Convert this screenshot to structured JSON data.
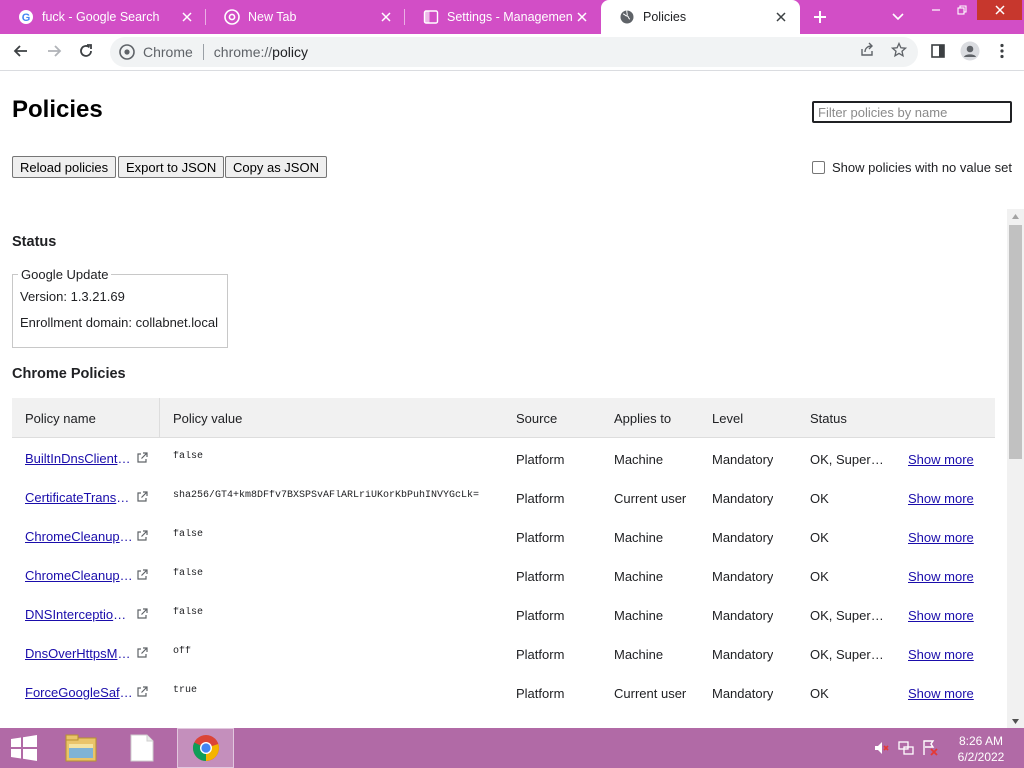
{
  "tabs": [
    {
      "title": "fuck - Google Search",
      "icon": "google-icon",
      "active": false
    },
    {
      "title": "New Tab",
      "icon": "chrome-icon",
      "active": false
    },
    {
      "title": "Settings - Management",
      "icon": "settings-icon",
      "active": false
    },
    {
      "title": "Policies",
      "icon": "globe-icon",
      "active": true
    }
  ],
  "omnibox": {
    "chip": "Chrome",
    "url_scheme": "chrome://",
    "url_host": "policy"
  },
  "page": {
    "title": "Policies",
    "filter_placeholder": "Filter policies by name",
    "buttons": {
      "reload": "Reload policies",
      "export": "Export to JSON",
      "copy": "Copy as JSON"
    },
    "show_no_value_label": "Show policies with no value set",
    "show_no_value_checked": false
  },
  "status": {
    "heading": "Status",
    "legend": "Google Update",
    "version": "Version: 1.3.21.69",
    "enrollment": "Enrollment domain: collabnet.local"
  },
  "chrome_policies": {
    "heading": "Chrome Policies",
    "columns": [
      "Policy name",
      "Policy value",
      "Source",
      "Applies to",
      "Level",
      "Status"
    ],
    "rows": [
      {
        "name": "BuiltInDnsClientEnabled",
        "value": "false",
        "source": "Platform",
        "applies": "Machine",
        "level": "Mandatory",
        "status": "OK, Superseding",
        "more": "Show more"
      },
      {
        "name": "CertificateTransparencyEnforcementDisabledForCas",
        "value": "sha256/GT4+km8DFfv7BXSPSvAFlARLriUKorKbPuhINVYGcLk=",
        "source": "Platform",
        "applies": "Current user",
        "level": "Mandatory",
        "status": "OK",
        "more": "Show more"
      },
      {
        "name": "ChromeCleanupEnabled",
        "value": "false",
        "source": "Platform",
        "applies": "Machine",
        "level": "Mandatory",
        "status": "OK",
        "more": "Show more"
      },
      {
        "name": "ChromeCleanupReportingEnabled",
        "value": "false",
        "source": "Platform",
        "applies": "Machine",
        "level": "Mandatory",
        "status": "OK",
        "more": "Show more"
      },
      {
        "name": "DNSInterceptionChecksEnabled",
        "value": "false",
        "source": "Platform",
        "applies": "Machine",
        "level": "Mandatory",
        "status": "OK, Superseding",
        "more": "Show more"
      },
      {
        "name": "DnsOverHttpsMode",
        "value": "off",
        "source": "Platform",
        "applies": "Machine",
        "level": "Mandatory",
        "status": "OK, Superseding",
        "more": "Show more"
      },
      {
        "name": "ForceGoogleSafeSearch",
        "value": "true",
        "source": "Platform",
        "applies": "Current user",
        "level": "Mandatory",
        "status": "OK",
        "more": "Show more"
      }
    ]
  },
  "taskbar": {
    "time": "8:26 AM",
    "date": "6/2/2022"
  },
  "colors": {
    "tabstrip": "#d24ec6",
    "taskbar": "#b16aa6",
    "link": "#1a0dab"
  }
}
